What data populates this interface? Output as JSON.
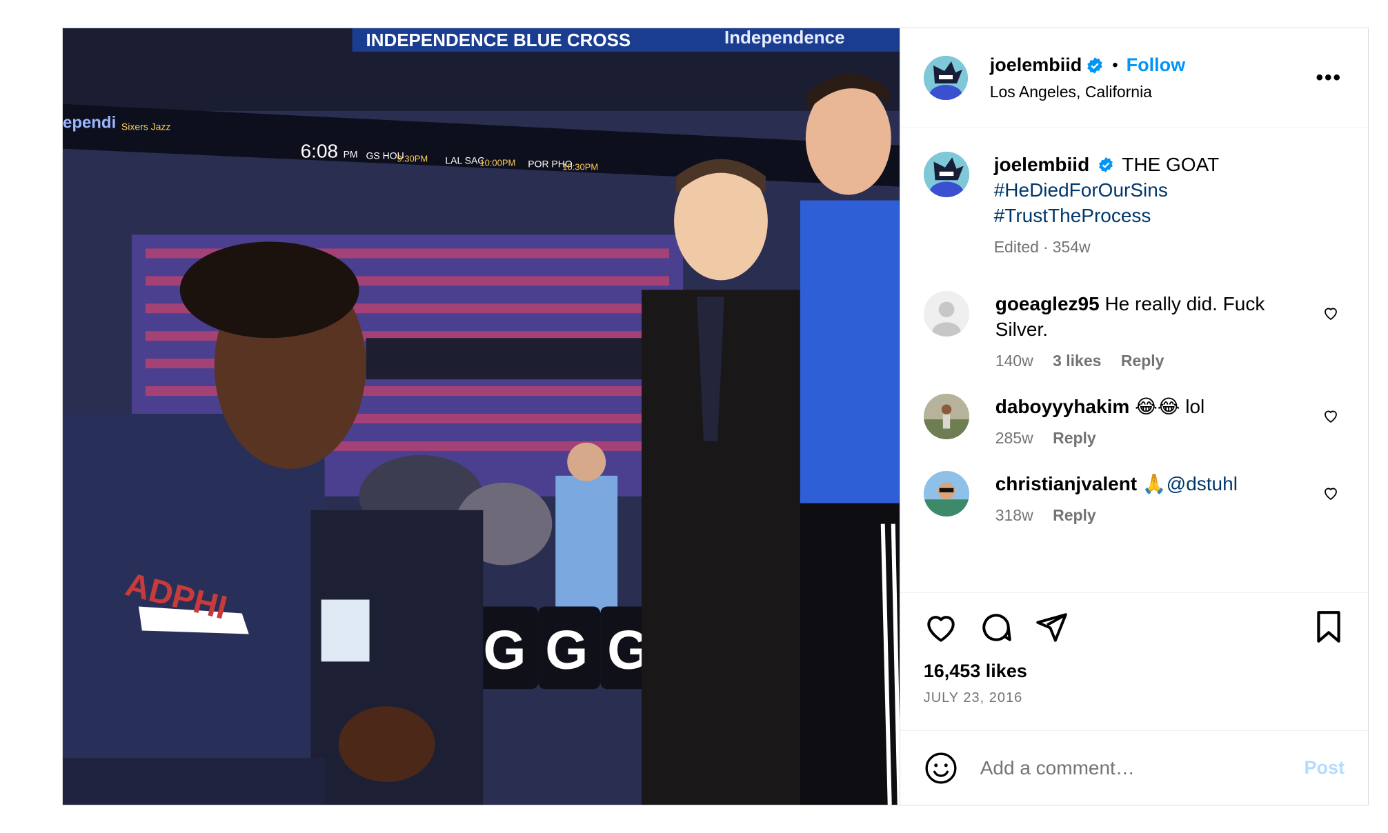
{
  "author": {
    "username": "joelembiid",
    "location": "Los Angeles, California",
    "follow_label": "Follow",
    "more_label": "•••"
  },
  "caption": {
    "username": "joelembiid",
    "text": "THE GOAT",
    "hashtags": [
      "#HeDiedForOurSins",
      "#TrustTheProcess"
    ],
    "edited": "Edited",
    "age": "354w"
  },
  "comments": [
    {
      "username": "goeaglez95",
      "text": "He really did. Fuck Silver.",
      "age": "140w",
      "likes": "3 likes",
      "reply": "Reply"
    },
    {
      "username": "daboyyyhakim",
      "text": "😂😂 lol",
      "age": "285w",
      "reply": "Reply"
    },
    {
      "username": "christianjvalent",
      "text": "🙏",
      "mention": "@dstuhl",
      "age": "318w",
      "reply": "Reply"
    }
  ],
  "stats": {
    "likes": "16,453 likes",
    "date": "JULY 23, 2016"
  },
  "composer": {
    "placeholder": "Add a comment…",
    "post_label": "Post"
  },
  "photo": {
    "banner_left": "INDEPENDENCE BLUE CROSS",
    "banner_right": "Independence",
    "scoreboard_left": "ependi",
    "scoreboard_teams": "Sixers Jazz",
    "clock": "6:08",
    "clock_suffix": "PM",
    "games": [
      "GS HOU",
      "9:30PM",
      "LAL SAC",
      "10:00PM",
      "POR PHO",
      "10:30PM"
    ]
  },
  "colors": {
    "accent": "#0095f6",
    "link": "#00376b",
    "muted": "#737373",
    "border": "#dbdbdb"
  }
}
